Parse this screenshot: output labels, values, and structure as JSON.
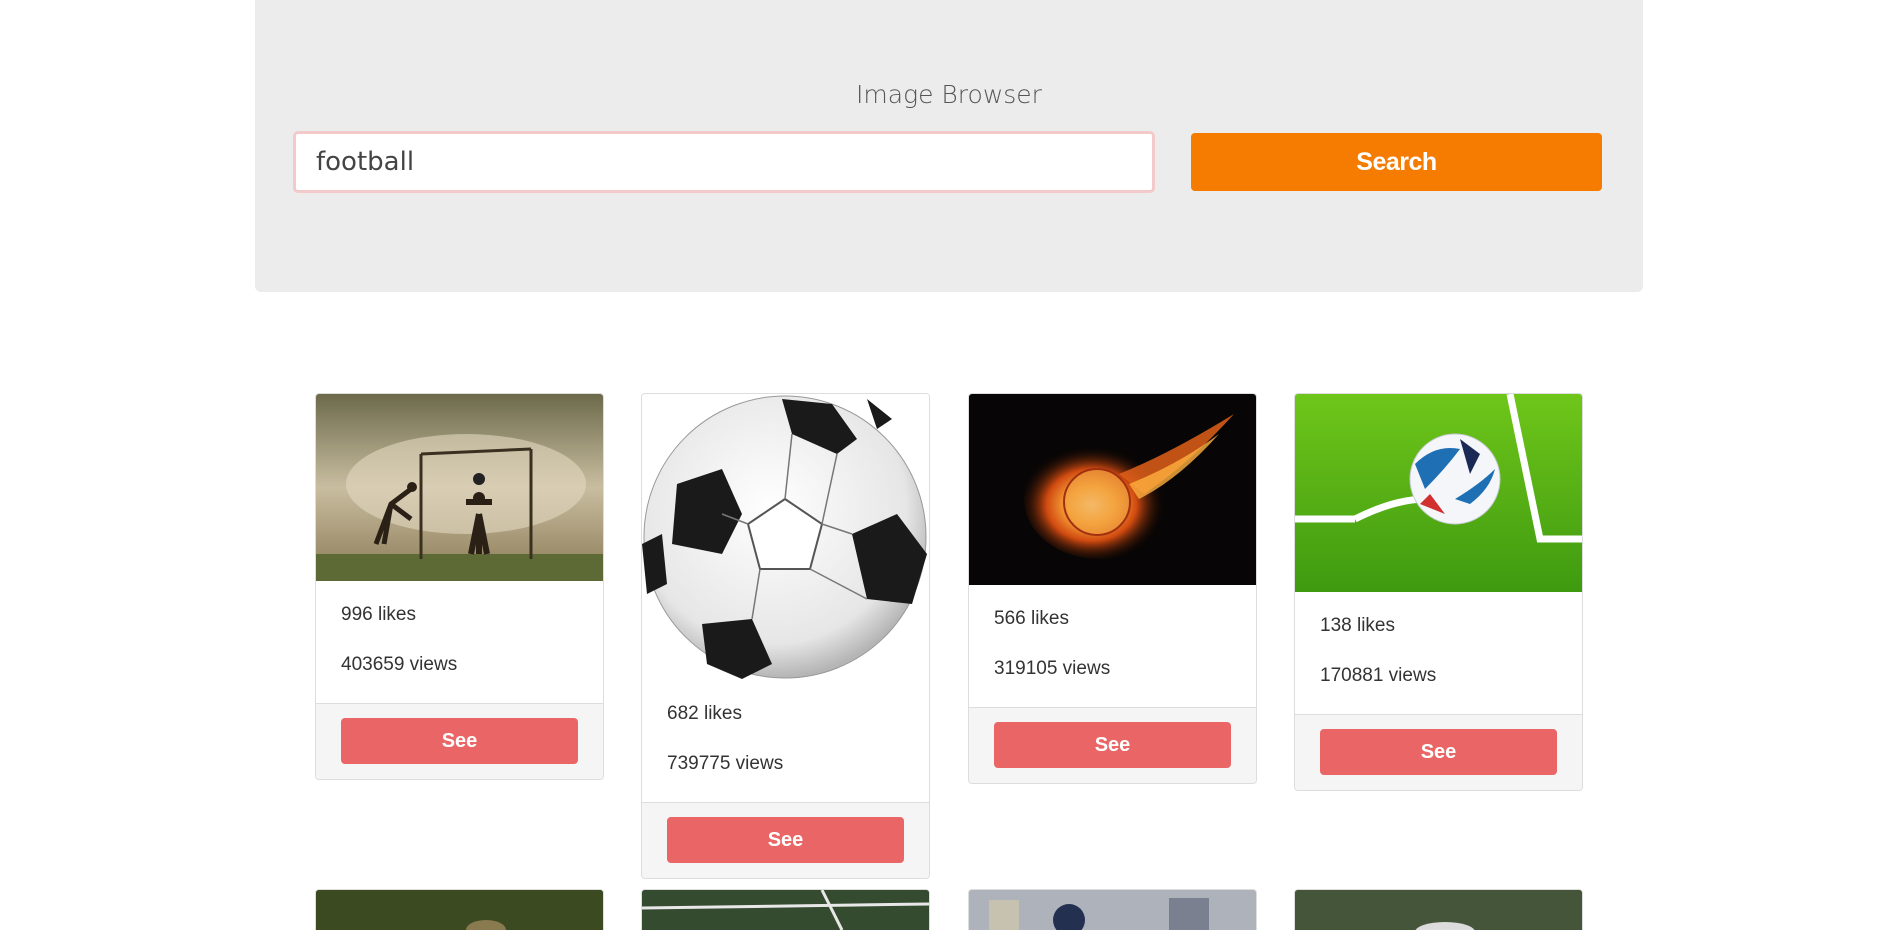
{
  "header": {
    "title": "Image Browser",
    "search_value": "football",
    "search_button": "Search"
  },
  "cards": [
    {
      "likes": "996 likes",
      "views": "403659 views",
      "button": "See",
      "image": "kids-playing-football-photo"
    },
    {
      "likes": "682 likes",
      "views": "739775 views",
      "button": "See",
      "image": "soccer-ball-illustration"
    },
    {
      "likes": "566 likes",
      "views": "319105 views",
      "button": "See",
      "image": "flaming-ball-photo"
    },
    {
      "likes": "138 likes",
      "views": "170881 views",
      "button": "See",
      "image": "ball-on-pitch-corner-photo"
    }
  ],
  "colors": {
    "accent": "#f57c00",
    "see_button": "#ea6666",
    "jumbotron": "#ececec"
  }
}
